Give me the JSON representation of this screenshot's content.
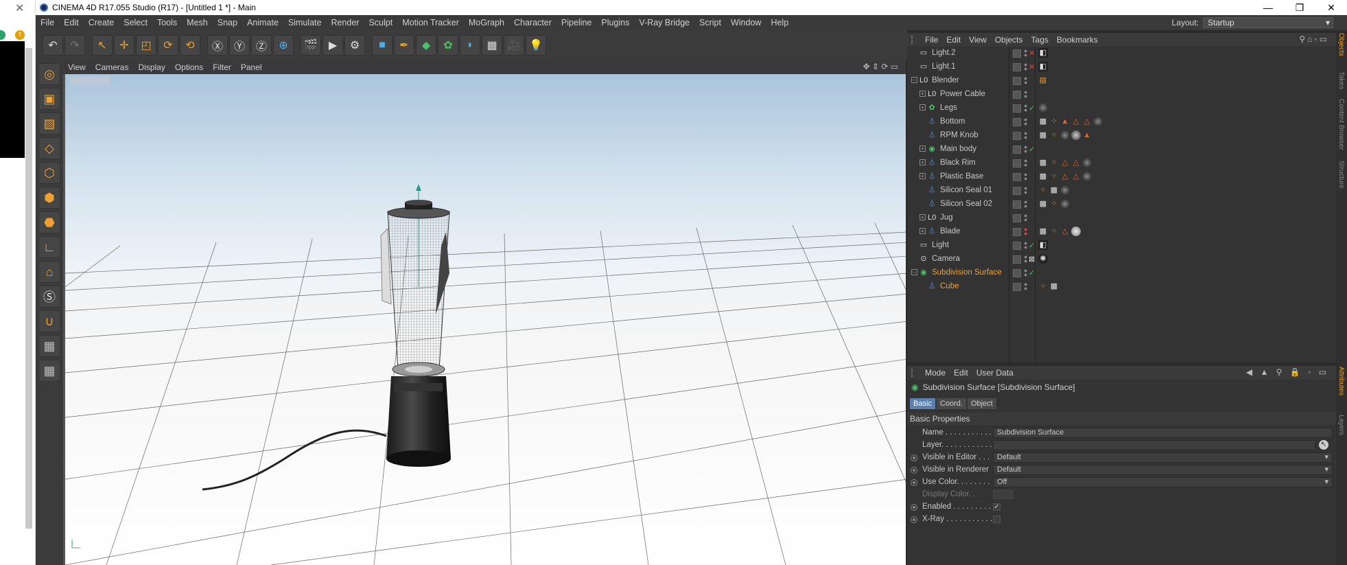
{
  "window": {
    "title": "CINEMA 4D R17.055 Studio (R17) - [Untitled 1 *] - Main"
  },
  "menu": [
    "File",
    "Edit",
    "Create",
    "Select",
    "Tools",
    "Mesh",
    "Snap",
    "Animate",
    "Simulate",
    "Render",
    "Sculpt",
    "Motion Tracker",
    "MoGraph",
    "Character",
    "Pipeline",
    "Plugins",
    "V-Ray Bridge",
    "Script",
    "Window",
    "Help"
  ],
  "layout": {
    "label": "Layout:",
    "value": "Startup"
  },
  "viewport": {
    "menu": [
      "View",
      "Cameras",
      "Display",
      "Options",
      "Filter",
      "Panel"
    ]
  },
  "objects": {
    "menu": [
      "File",
      "Edit",
      "View",
      "Objects",
      "Tags",
      "Bookmarks"
    ],
    "items": [
      {
        "name": "Light.2",
        "indent": 0,
        "icon": "light",
        "expand": "",
        "state": "x"
      },
      {
        "name": "Light.1",
        "indent": 0,
        "icon": "light",
        "expand": "",
        "state": "x"
      },
      {
        "name": "Blender",
        "indent": 0,
        "icon": "null",
        "expand": "-",
        "state": ""
      },
      {
        "name": "Power Cable",
        "indent": 1,
        "icon": "null",
        "expand": "+",
        "state": ""
      },
      {
        "name": "Legs",
        "indent": 1,
        "icon": "generator",
        "expand": "+",
        "state": "check"
      },
      {
        "name": "Bottom",
        "indent": 1,
        "icon": "polygon",
        "expand": "",
        "state": ""
      },
      {
        "name": "RPM Knob",
        "indent": 1,
        "icon": "polygon",
        "expand": "",
        "state": ""
      },
      {
        "name": "Main body",
        "indent": 1,
        "icon": "generator",
        "expand": "+",
        "state": "check"
      },
      {
        "name": "Black Rim",
        "indent": 1,
        "icon": "polygon",
        "expand": "+",
        "state": ""
      },
      {
        "name": "Plastic Base",
        "indent": 1,
        "icon": "polygon",
        "expand": "+",
        "state": ""
      },
      {
        "name": "Silicon Seal 01",
        "indent": 1,
        "icon": "polygon",
        "expand": "",
        "state": ""
      },
      {
        "name": "Silicon Seal 02",
        "indent": 1,
        "icon": "polygon",
        "expand": "",
        "state": ""
      },
      {
        "name": "Jug",
        "indent": 1,
        "icon": "null",
        "expand": "+",
        "state": ""
      },
      {
        "name": "Blade",
        "indent": 1,
        "icon": "polygon",
        "expand": "+",
        "state": ""
      },
      {
        "name": "Light",
        "indent": 0,
        "icon": "light",
        "expand": "",
        "state": "check"
      },
      {
        "name": "Camera",
        "indent": 0,
        "icon": "camera",
        "expand": "",
        "state": ""
      },
      {
        "name": "Subdivision Surface",
        "indent": 0,
        "icon": "generator",
        "expand": "-",
        "state": "check",
        "selected": true
      },
      {
        "name": "Cube",
        "indent": 1,
        "icon": "polygon",
        "expand": "",
        "state": "",
        "selected": true
      }
    ]
  },
  "attributes": {
    "menu": [
      "Mode",
      "Edit",
      "User Data"
    ],
    "title": "Subdivision Surface [Subdivision Surface]",
    "tabs": [
      "Basic",
      "Coord.",
      "Object"
    ],
    "active_tab": "Basic",
    "section": "Basic Properties",
    "props": {
      "name": {
        "label": "Name . . . . . . . . . . . .",
        "value": "Subdivision Surface"
      },
      "layer": {
        "label": "Layer. . . . . . . . . . . .",
        "value": ""
      },
      "visible_editor": {
        "label": "Visible in Editor . . .",
        "value": "Default"
      },
      "visible_renderer": {
        "label": "Visible in Renderer",
        "value": "Default"
      },
      "use_color": {
        "label": "Use Color. . . . . . . .",
        "value": "Off"
      },
      "display_color": {
        "label": "Display Color. . .",
        "value": ""
      },
      "enabled": {
        "label": "Enabled . . . . . . . . . .",
        "value": "✓"
      },
      "xray": {
        "label": "X-Ray . . . . . . . . . . . .",
        "value": ""
      }
    }
  },
  "right_tabs": [
    "Objects",
    "Takes",
    "Content Browser",
    "Structure",
    "Attributes",
    "Layers"
  ],
  "colors": {
    "accent": "#f0a030",
    "selected_tab": "#5a7fb0",
    "generator_green": "#4bc06a",
    "panel_bg": "#333333"
  }
}
